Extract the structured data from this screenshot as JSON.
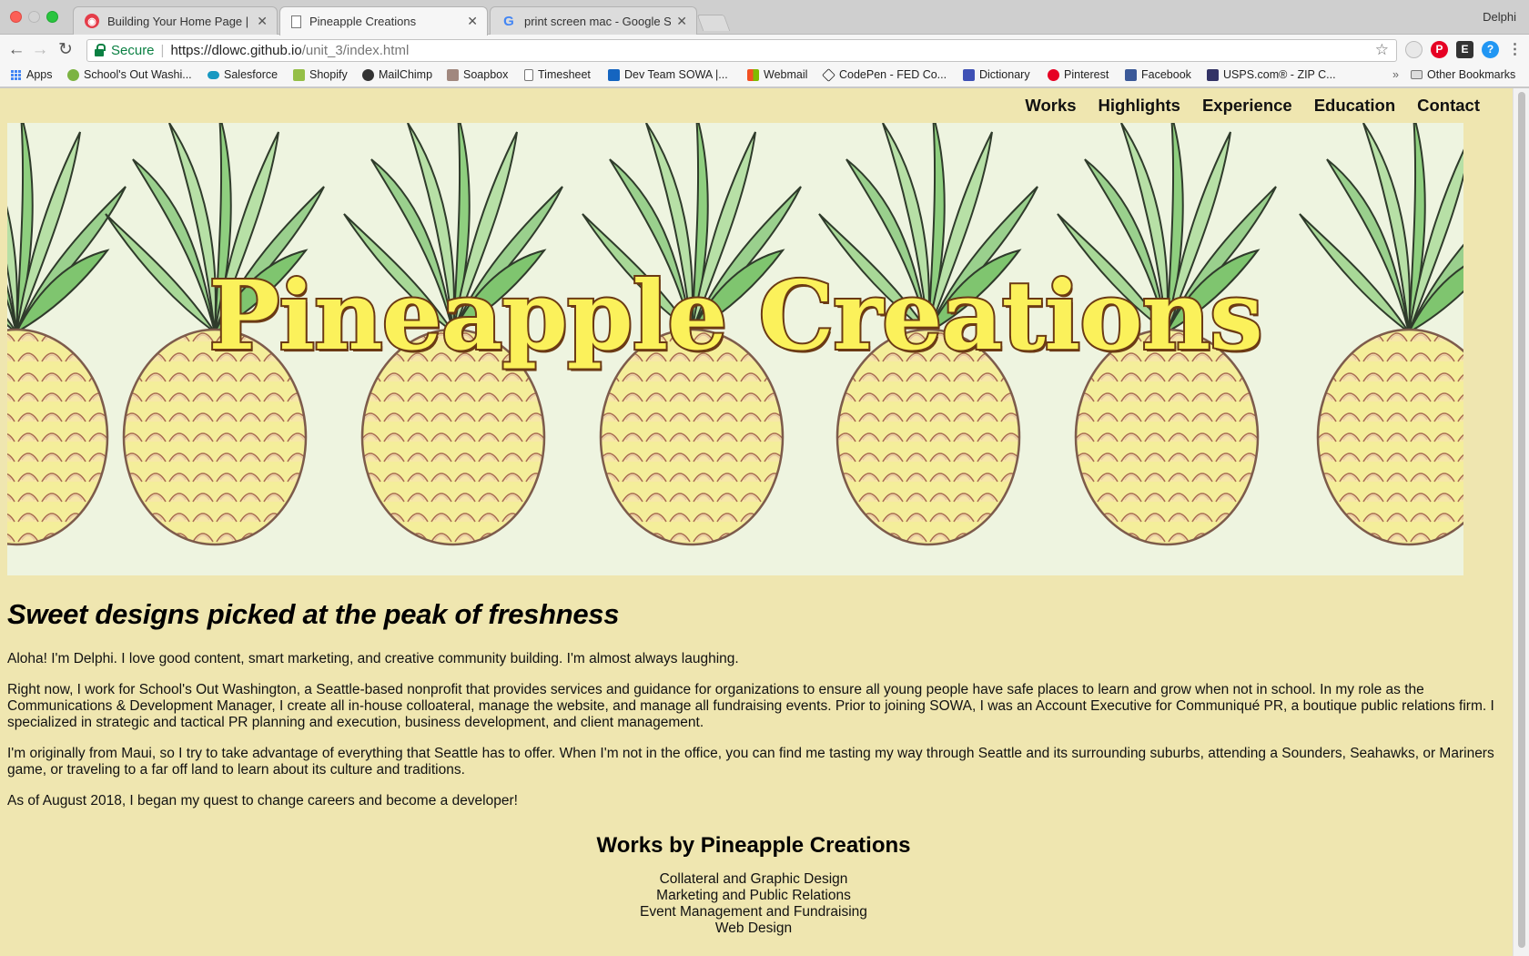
{
  "browser": {
    "tabs": [
      {
        "title": "Building Your Home Page | HTML",
        "favicon": "red-circle-icon",
        "active": false
      },
      {
        "title": "Pineapple Creations",
        "favicon": "document-icon",
        "active": true
      },
      {
        "title": "print screen mac - Google Search",
        "favicon": "google-icon",
        "active": false
      }
    ],
    "profile": "Delphi",
    "address": {
      "secure_label": "Secure",
      "scheme_host": "https://dlowc.github.io",
      "path": "/unit_3/index.html"
    },
    "bookmarks": [
      {
        "label": "Apps"
      },
      {
        "label": "School's Out Washi..."
      },
      {
        "label": "Salesforce"
      },
      {
        "label": "Shopify"
      },
      {
        "label": "MailChimp"
      },
      {
        "label": "Soapbox"
      },
      {
        "label": "Timesheet"
      },
      {
        "label": "Dev Team SOWA |..."
      },
      {
        "label": "Webmail"
      },
      {
        "label": "CodePen - FED Co..."
      },
      {
        "label": "Dictionary"
      },
      {
        "label": "Pinterest"
      },
      {
        "label": "Facebook"
      },
      {
        "label": "USPS.com® - ZIP C..."
      },
      {
        "label": "»"
      },
      {
        "label": "Other Bookmarks"
      }
    ]
  },
  "page": {
    "nav": [
      "Works",
      "Highlights",
      "Experience",
      "Education",
      "Contact"
    ],
    "hero_title": "Pineapple Creations",
    "tagline": "Sweet designs picked at the peak of freshness",
    "paragraphs": [
      "Aloha! I'm Delphi. I love good content, smart marketing, and creative community building. I'm almost always laughing.",
      "Right now, I work for School's Out Washington, a Seattle-based nonprofit that provides services and guidance for organizations to ensure all young people have safe places to learn and grow when not in school. In my role as the Communications & Development Manager, I create all in-house colloateral, manage the website, and manage all fundraising events. Prior to joining SOWA, I was an Account Executive for Communiqué PR, a boutique public relations firm. I specialized in strategic and tactical PR planning and execution, business development, and client management.",
      "I'm originally from Maui, so I try to take advantage of everything that Seattle has to offer. When I'm not in the office, you can find me tasting my way through Seattle and its surrounding suburbs, attending a Sounders, Seahawks, or Mariners game, or traveling to a far off land to learn about its culture and traditions.",
      "As of August 2018, I began my quest to change careers and become a developer!"
    ],
    "works_heading": "Works by Pineapple Creations",
    "works": [
      "Collateral and Graphic Design",
      "Marketing and Public Relations",
      "Event Management and Fundraising",
      "Web Design"
    ]
  }
}
